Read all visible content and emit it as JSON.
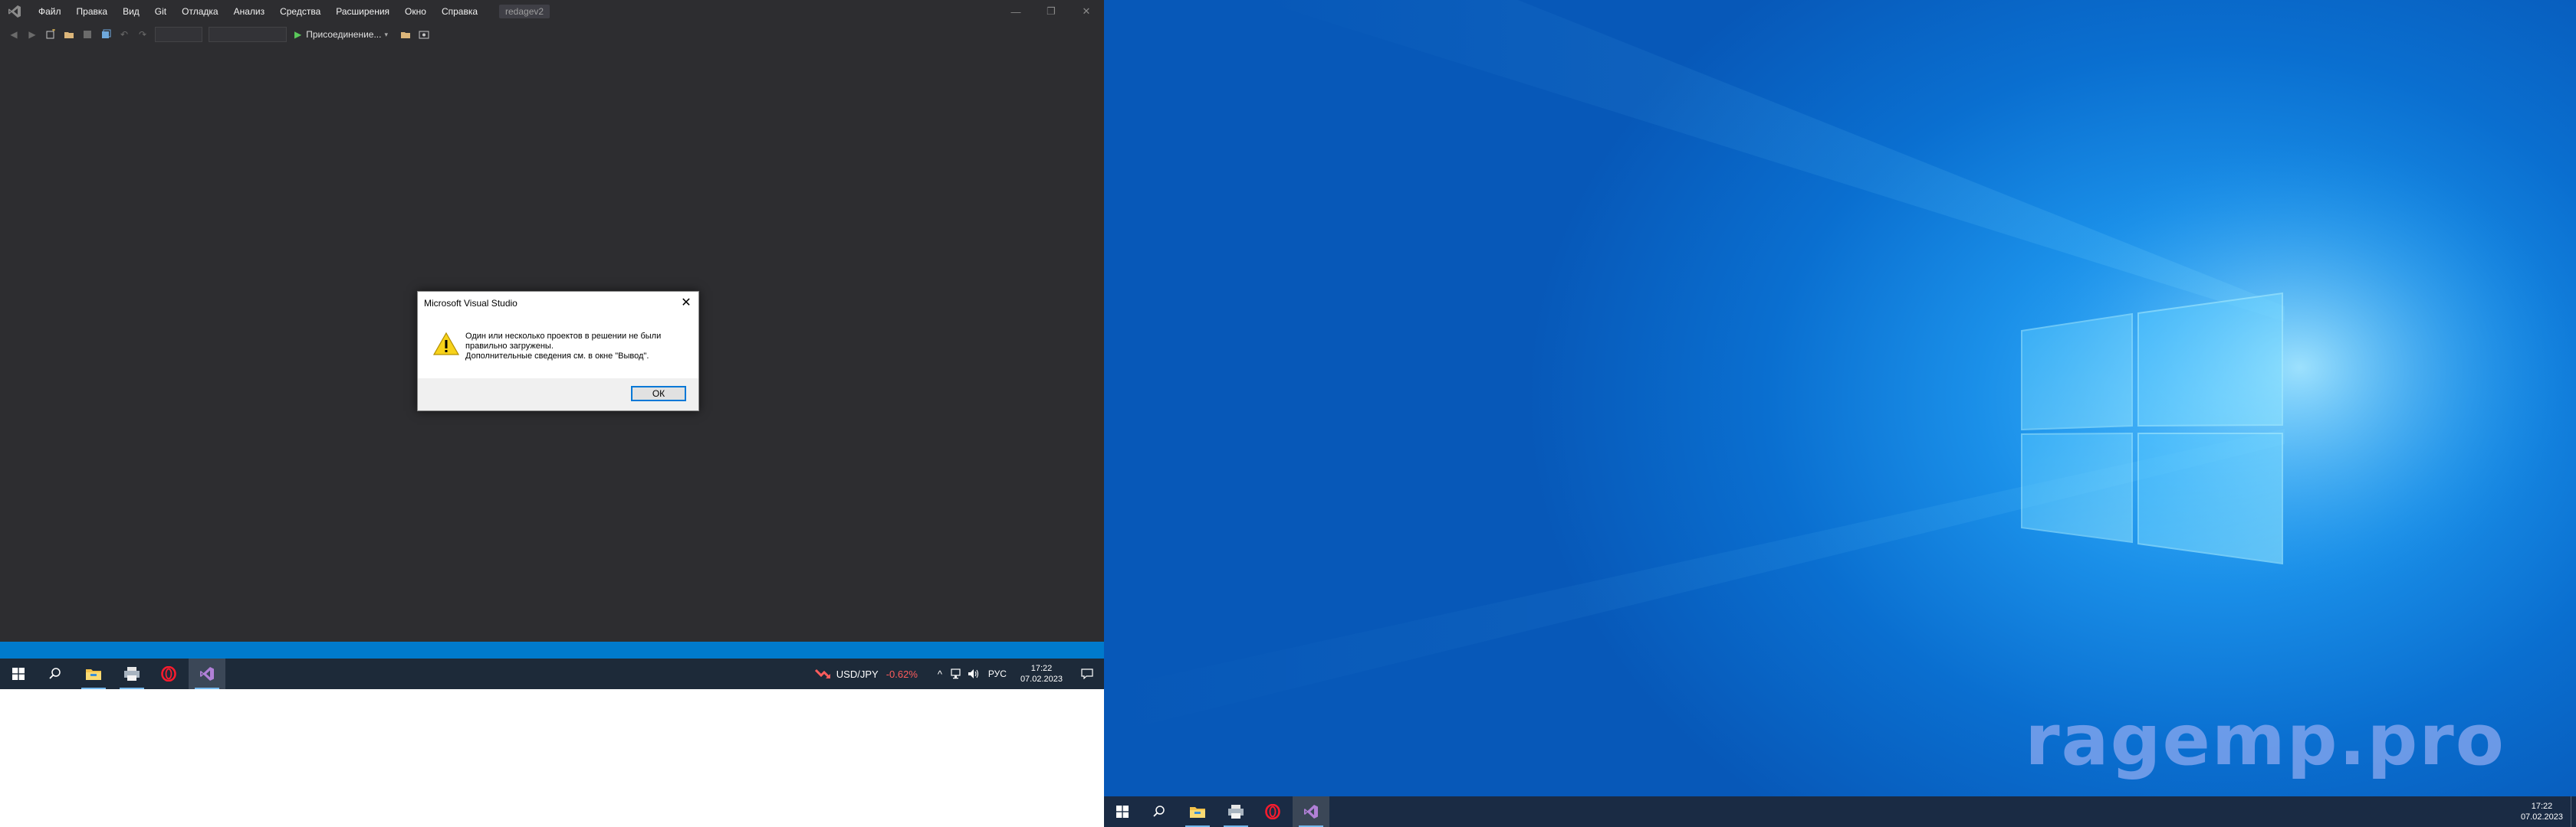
{
  "vs": {
    "menu": [
      "Файл",
      "Правка",
      "Вид",
      "Git",
      "Отладка",
      "Анализ",
      "Средства",
      "Расширения",
      "Окно",
      "Справка"
    ],
    "solution_name": "redagev2",
    "toolbar": {
      "attach_label": "Присоединение..."
    }
  },
  "dialog": {
    "title": "Microsoft Visual Studio",
    "message_lines": [
      "Один или несколько проектов в решении не были",
      "правильно загружены.",
      "Дополнительные сведения см. в окне \"Вывод\"."
    ],
    "ok_label": "ОК"
  },
  "left_taskbar": {
    "ticker": {
      "name": "USD/JPY",
      "change": "-0.62%"
    },
    "language": "РУС",
    "time": "17:22",
    "date": "07.02.2023"
  },
  "right_taskbar": {
    "time": "17:22",
    "date": "07.02.2023"
  },
  "wallpaper": {
    "watermark": "ragemp.pro"
  },
  "colors": {
    "vs_background": "#2d2d30",
    "status_bar": "#007acc",
    "taskbar": "#1d2a39",
    "ticker_negative": "#ff5c5c",
    "desktop_blue": "#0a6fd0"
  }
}
